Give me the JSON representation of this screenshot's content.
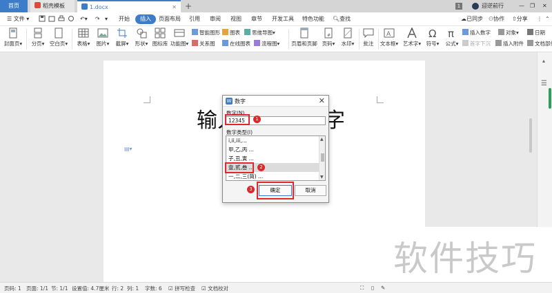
{
  "tabs": {
    "home": "首页",
    "templates": "稻壳模板",
    "doc": "1.docx",
    "new_tab": "+"
  },
  "titlebar": {
    "badge": "1",
    "user": "迎逆前行"
  },
  "menu": {
    "file": "文件",
    "items": [
      "开始",
      "插入",
      "页面布局",
      "引用",
      "审阅",
      "视图",
      "章节",
      "开发工具",
      "特色功能"
    ],
    "search": "查找",
    "sync": "已同步",
    "collab": "协作",
    "share": "分享"
  },
  "ribbon": {
    "big": [
      "封面页",
      "分页",
      "空白页",
      "表格",
      "图片",
      "截屏",
      "形状",
      "图标库",
      "功能图",
      "页眉和页脚",
      "页码",
      "水印",
      "批注",
      "文本框",
      "艺术字",
      "符号",
      "公式"
    ],
    "small": [
      "智能图形",
      "图表",
      "思维导图",
      "关系图",
      "在线图表",
      "流程图",
      "插入数字",
      "对象",
      "日期",
      "首字下沉",
      "插入附件",
      "文档部件"
    ]
  },
  "document": {
    "text_visible": "输入",
    "text_tail": "字"
  },
  "dialog": {
    "title": "数字",
    "number_label": "数字(N)",
    "number_value": "12345",
    "type_label": "数字类型(I)",
    "list": [
      "i,ii,iii,...",
      "甲,乙,丙 ...",
      "子,丑,寅 ...",
      "壹,贰,叁 ...",
      "一,二,三(简) ..."
    ],
    "selected_index": 3,
    "ok": "确定",
    "cancel": "取消"
  },
  "annotations": {
    "step1": "1",
    "step2": "2",
    "step3": "3",
    "color": "#e0262a"
  },
  "watermark": "软件技巧",
  "status": {
    "page_no": "页码: 1",
    "page": "页面: 1/1",
    "section": "节: 1/1",
    "setting": "设置值: 4.7厘米",
    "row": "行: 2",
    "col": "列: 1",
    "words": "字数: 6",
    "spell": "拼写检查",
    "proof": "文档校对"
  },
  "colors": {
    "accent": "#3d7cc9",
    "active_green": "#2f9e5b"
  }
}
